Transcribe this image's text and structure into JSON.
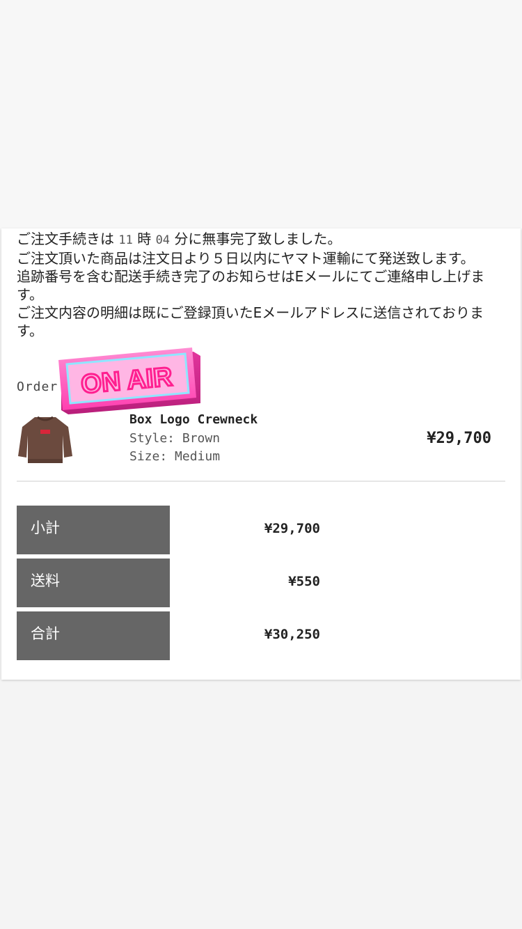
{
  "message": {
    "line1_prefix": "ご注文手続きは",
    "hour": "11",
    "hour_unit": "時",
    "minute": "04",
    "line1_suffix": "分に無事完了致しました。",
    "line2": "ご注文頂いた商品は注文日より５日以内にヤマト運輸にて発送致します。",
    "line3": "追跡番号を含む配送手続き完了のお知らせはEメールにてご連絡申し上げます。",
    "line4": "ご注文内容の明細は既にご登録頂いたEメールアドレスに送信されております。"
  },
  "order": {
    "label": "Order"
  },
  "product": {
    "name": "Box Logo Crewneck",
    "style": "Style: Brown",
    "size": "Size: Medium",
    "price": "¥29,700"
  },
  "summary": {
    "subtotal_label": "小計",
    "subtotal_value": "¥29,700",
    "shipping_label": "送料",
    "shipping_value": "¥550",
    "total_label": "合計",
    "total_value": "¥30,250"
  },
  "sticker": {
    "text": "ON AIR"
  },
  "colors": {
    "summary_label_bg": "#666666",
    "sticker_pink": "#ff4fb8",
    "product_brown": "#6b4a3e",
    "logo_red": "#d8263a"
  },
  "icons": {
    "product_image": "crewneck-sweatshirt-icon",
    "sticker": "on-air-neon-sign-icon"
  }
}
